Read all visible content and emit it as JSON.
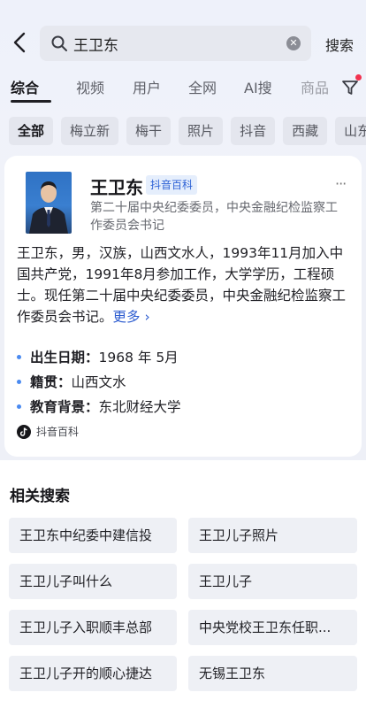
{
  "search": {
    "query": "王卫东",
    "search_button": "搜索"
  },
  "tabs": [
    {
      "label": "综合",
      "active": true
    },
    {
      "label": "视频"
    },
    {
      "label": "用户"
    },
    {
      "label": "全网"
    },
    {
      "label": "AI搜"
    },
    {
      "label": "商品"
    }
  ],
  "chips": [
    {
      "label": "全部",
      "active": true
    },
    {
      "label": "梅立新"
    },
    {
      "label": "梅干"
    },
    {
      "label": "照片"
    },
    {
      "label": "抖音"
    },
    {
      "label": "西藏"
    },
    {
      "label": "山东"
    }
  ],
  "card": {
    "name": "王卫东",
    "badge": "抖音百科",
    "subtitle": "第二十届中央纪委委员，中央金融纪检监察工作委员会书记",
    "description": "王卫东，男，汉族，山西文水人，1993年11月加入中国共产党，1991年8月参加工作，大学学历，工程硕士。现任第二十届中央纪委委员，中央金融纪检监察工作委员会书记。",
    "more_label": "更多 ›",
    "facts": [
      {
        "key": "出生日期：",
        "value": "1968 年 5月"
      },
      {
        "key": "籍贯：",
        "value": "山西文水"
      },
      {
        "key": "教育背景：",
        "value": "东北财经大学"
      }
    ],
    "source": "抖音百科"
  },
  "related": {
    "title": "相关搜索",
    "items": [
      "王卫东中纪委中建信投",
      "王卫儿子照片",
      "王卫儿子叫什么",
      "王卫儿子",
      "王卫儿子入职顺丰总部",
      "中央党校王卫东任职...",
      "王卫儿子开的顺心捷达",
      "无锡王卫东"
    ]
  },
  "colors": {
    "accent_blue": "#2f5ed0",
    "badge_bg": "#e5eefc",
    "notification_dot": "#f2324f"
  }
}
